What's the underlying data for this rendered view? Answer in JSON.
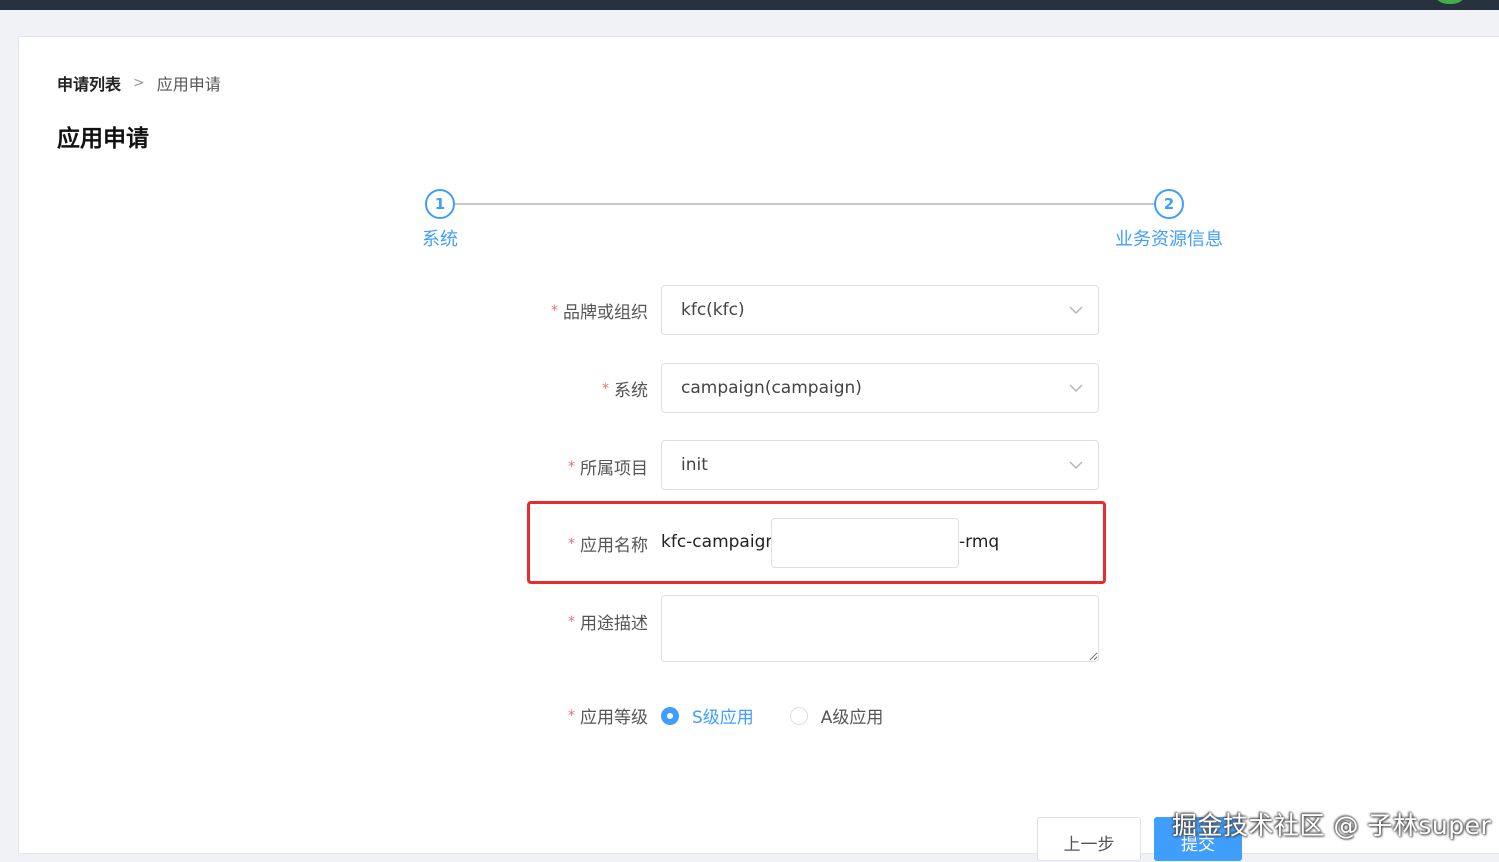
{
  "breadcrumb": {
    "first": "申请列表",
    "separator": ">",
    "current": "应用申请"
  },
  "page_title": "应用申请",
  "steps": [
    {
      "number": "1",
      "title": "系统"
    },
    {
      "number": "2",
      "title": "业务资源信息"
    }
  ],
  "form": {
    "required_mark": "*",
    "brand": {
      "label": "品牌或组织",
      "value": "kfc(kfc)"
    },
    "system": {
      "label": "系统",
      "value": "campaign(campaign)"
    },
    "project": {
      "label": "所属项目",
      "value": "init"
    },
    "app_name": {
      "label": "应用名称",
      "prefix": "kfc-campaign-",
      "value": "",
      "suffix": "-rmq"
    },
    "description": {
      "label": "用途描述",
      "value": ""
    },
    "level": {
      "label": "应用等级",
      "options": [
        {
          "label": "S级应用",
          "checked": true
        },
        {
          "label": "A级应用",
          "checked": false
        }
      ]
    }
  },
  "buttons": {
    "prev": "上一步",
    "submit": "提交"
  },
  "watermark": "掘金技术社区 @ 子林super",
  "colors": {
    "primary": "#409eff",
    "required": "#f56c6c",
    "highlight": "#e52d2d",
    "topbar": "#28323e"
  }
}
